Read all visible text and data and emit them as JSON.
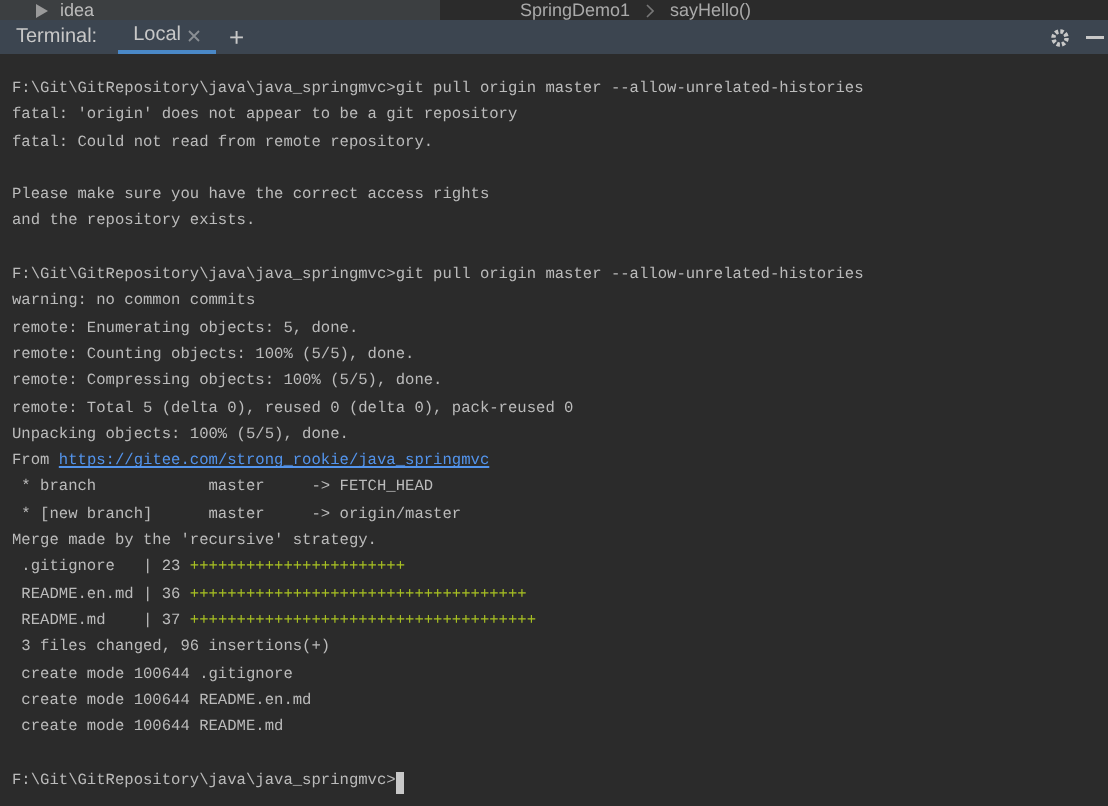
{
  "top_strip": {
    "tree_item": "idea",
    "breadcrumb": [
      "SpringDemo1",
      "sayHello()"
    ]
  },
  "terminal": {
    "title": "Terminal:",
    "tabs": [
      {
        "label": "Local",
        "selected": true
      }
    ],
    "new_tab": "+"
  },
  "lines": [
    {
      "kind": "prompt",
      "text": "F:\\Git\\GitRepository\\java\\java_springmvc>git pull origin master --allow-unrelated-histories"
    },
    {
      "kind": "plain",
      "text": "fatal: 'origin' does not appear to be a git repository"
    },
    {
      "kind": "plain",
      "text": "fatal: Could not read from remote repository."
    },
    {
      "kind": "blank"
    },
    {
      "kind": "plain",
      "text": "Please make sure you have the correct access rights"
    },
    {
      "kind": "plain",
      "text": "and the repository exists."
    },
    {
      "kind": "blank"
    },
    {
      "kind": "prompt",
      "text": "F:\\Git\\GitRepository\\java\\java_springmvc>git pull origin master --allow-unrelated-histories"
    },
    {
      "kind": "plain",
      "text": "warning: no common commits"
    },
    {
      "kind": "plain",
      "text": "remote: Enumerating objects: 5, done."
    },
    {
      "kind": "plain",
      "text": "remote: Counting objects: 100% (5/5), done."
    },
    {
      "kind": "plain",
      "text": "remote: Compressing objects: 100% (5/5), done."
    },
    {
      "kind": "plain",
      "text": "remote: Total 5 (delta 0), reused 0 (delta 0), pack-reused 0"
    },
    {
      "kind": "plain",
      "text": "Unpacking objects: 100% (5/5), done."
    },
    {
      "kind": "link",
      "text": "From ",
      "link": "https://gitee.com/strong_rookie/java_springmvc"
    },
    {
      "kind": "plain",
      "text": " * branch            master     -> FETCH_HEAD"
    },
    {
      "kind": "plain",
      "text": " * [new branch]      master     -> origin/master"
    },
    {
      "kind": "plain",
      "text": "Merge made by the 'recursive' strategy."
    },
    {
      "kind": "stat",
      "text": " .gitignore   | 23 ",
      "bar": "+++++++++++++++++++++++"
    },
    {
      "kind": "stat",
      "text": " README.en.md | 36 ",
      "bar": "++++++++++++++++++++++++++++++++++++"
    },
    {
      "kind": "stat",
      "text": " README.md    | 37 ",
      "bar": "+++++++++++++++++++++++++++++++++++++"
    },
    {
      "kind": "plain",
      "text": " 3 files changed, 96 insertions(+)"
    },
    {
      "kind": "plain",
      "text": " create mode 100644 .gitignore"
    },
    {
      "kind": "plain",
      "text": " create mode 100644 README.en.md"
    },
    {
      "kind": "plain",
      "text": " create mode 100644 README.md"
    },
    {
      "kind": "blank"
    },
    {
      "kind": "prompt",
      "text": "F:\\Git\\GitRepository\\java\\java_springmvc>",
      "cursor": true
    }
  ]
}
